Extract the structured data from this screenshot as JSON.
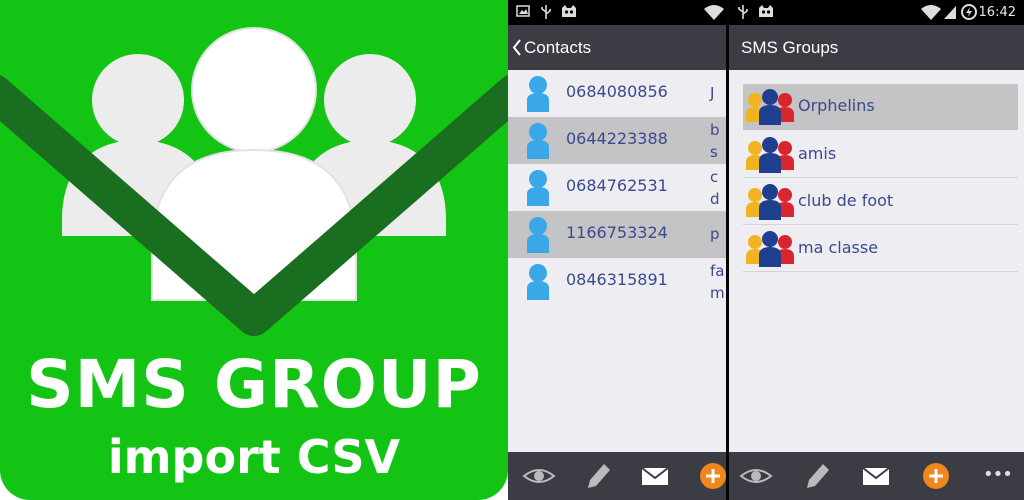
{
  "promo": {
    "title": "SMS GROUP",
    "subtitle": "import CSV",
    "brand_color": "#14c414"
  },
  "contacts_screen": {
    "title": "Contacts",
    "contacts": [
      {
        "phone": "0684080856",
        "name_fragment": "J",
        "selected": false
      },
      {
        "phone": "0644223388",
        "name_fragment": "b s",
        "selected": true
      },
      {
        "phone": "0684762531",
        "name_fragment": "c d",
        "selected": false
      },
      {
        "phone": "1166753324",
        "name_fragment": "p",
        "selected": true
      },
      {
        "phone": "0846315891",
        "name_fragment": "fa m",
        "selected": false
      }
    ],
    "bottom_actions": [
      "eye-icon",
      "pencil-icon",
      "envelope-icon",
      "add-icon"
    ]
  },
  "groups_screen": {
    "title": "SMS Groups",
    "clock": "16:42",
    "groups": [
      {
        "name": "Orphelins",
        "selected": true
      },
      {
        "name": "amis",
        "selected": false
      },
      {
        "name": "club de foot",
        "selected": false
      },
      {
        "name": "ma classe",
        "selected": false
      }
    ],
    "bottom_actions": [
      "eye-icon",
      "pencil-icon",
      "envelope-icon",
      "add-icon",
      "overflow-menu-icon"
    ]
  },
  "colors": {
    "action_bar": "#3b3c44",
    "list_background": "#eeeef2",
    "selected_row": "#c4c4c6",
    "list_text": "#3a4a8e",
    "add_button": "#f0861c"
  }
}
